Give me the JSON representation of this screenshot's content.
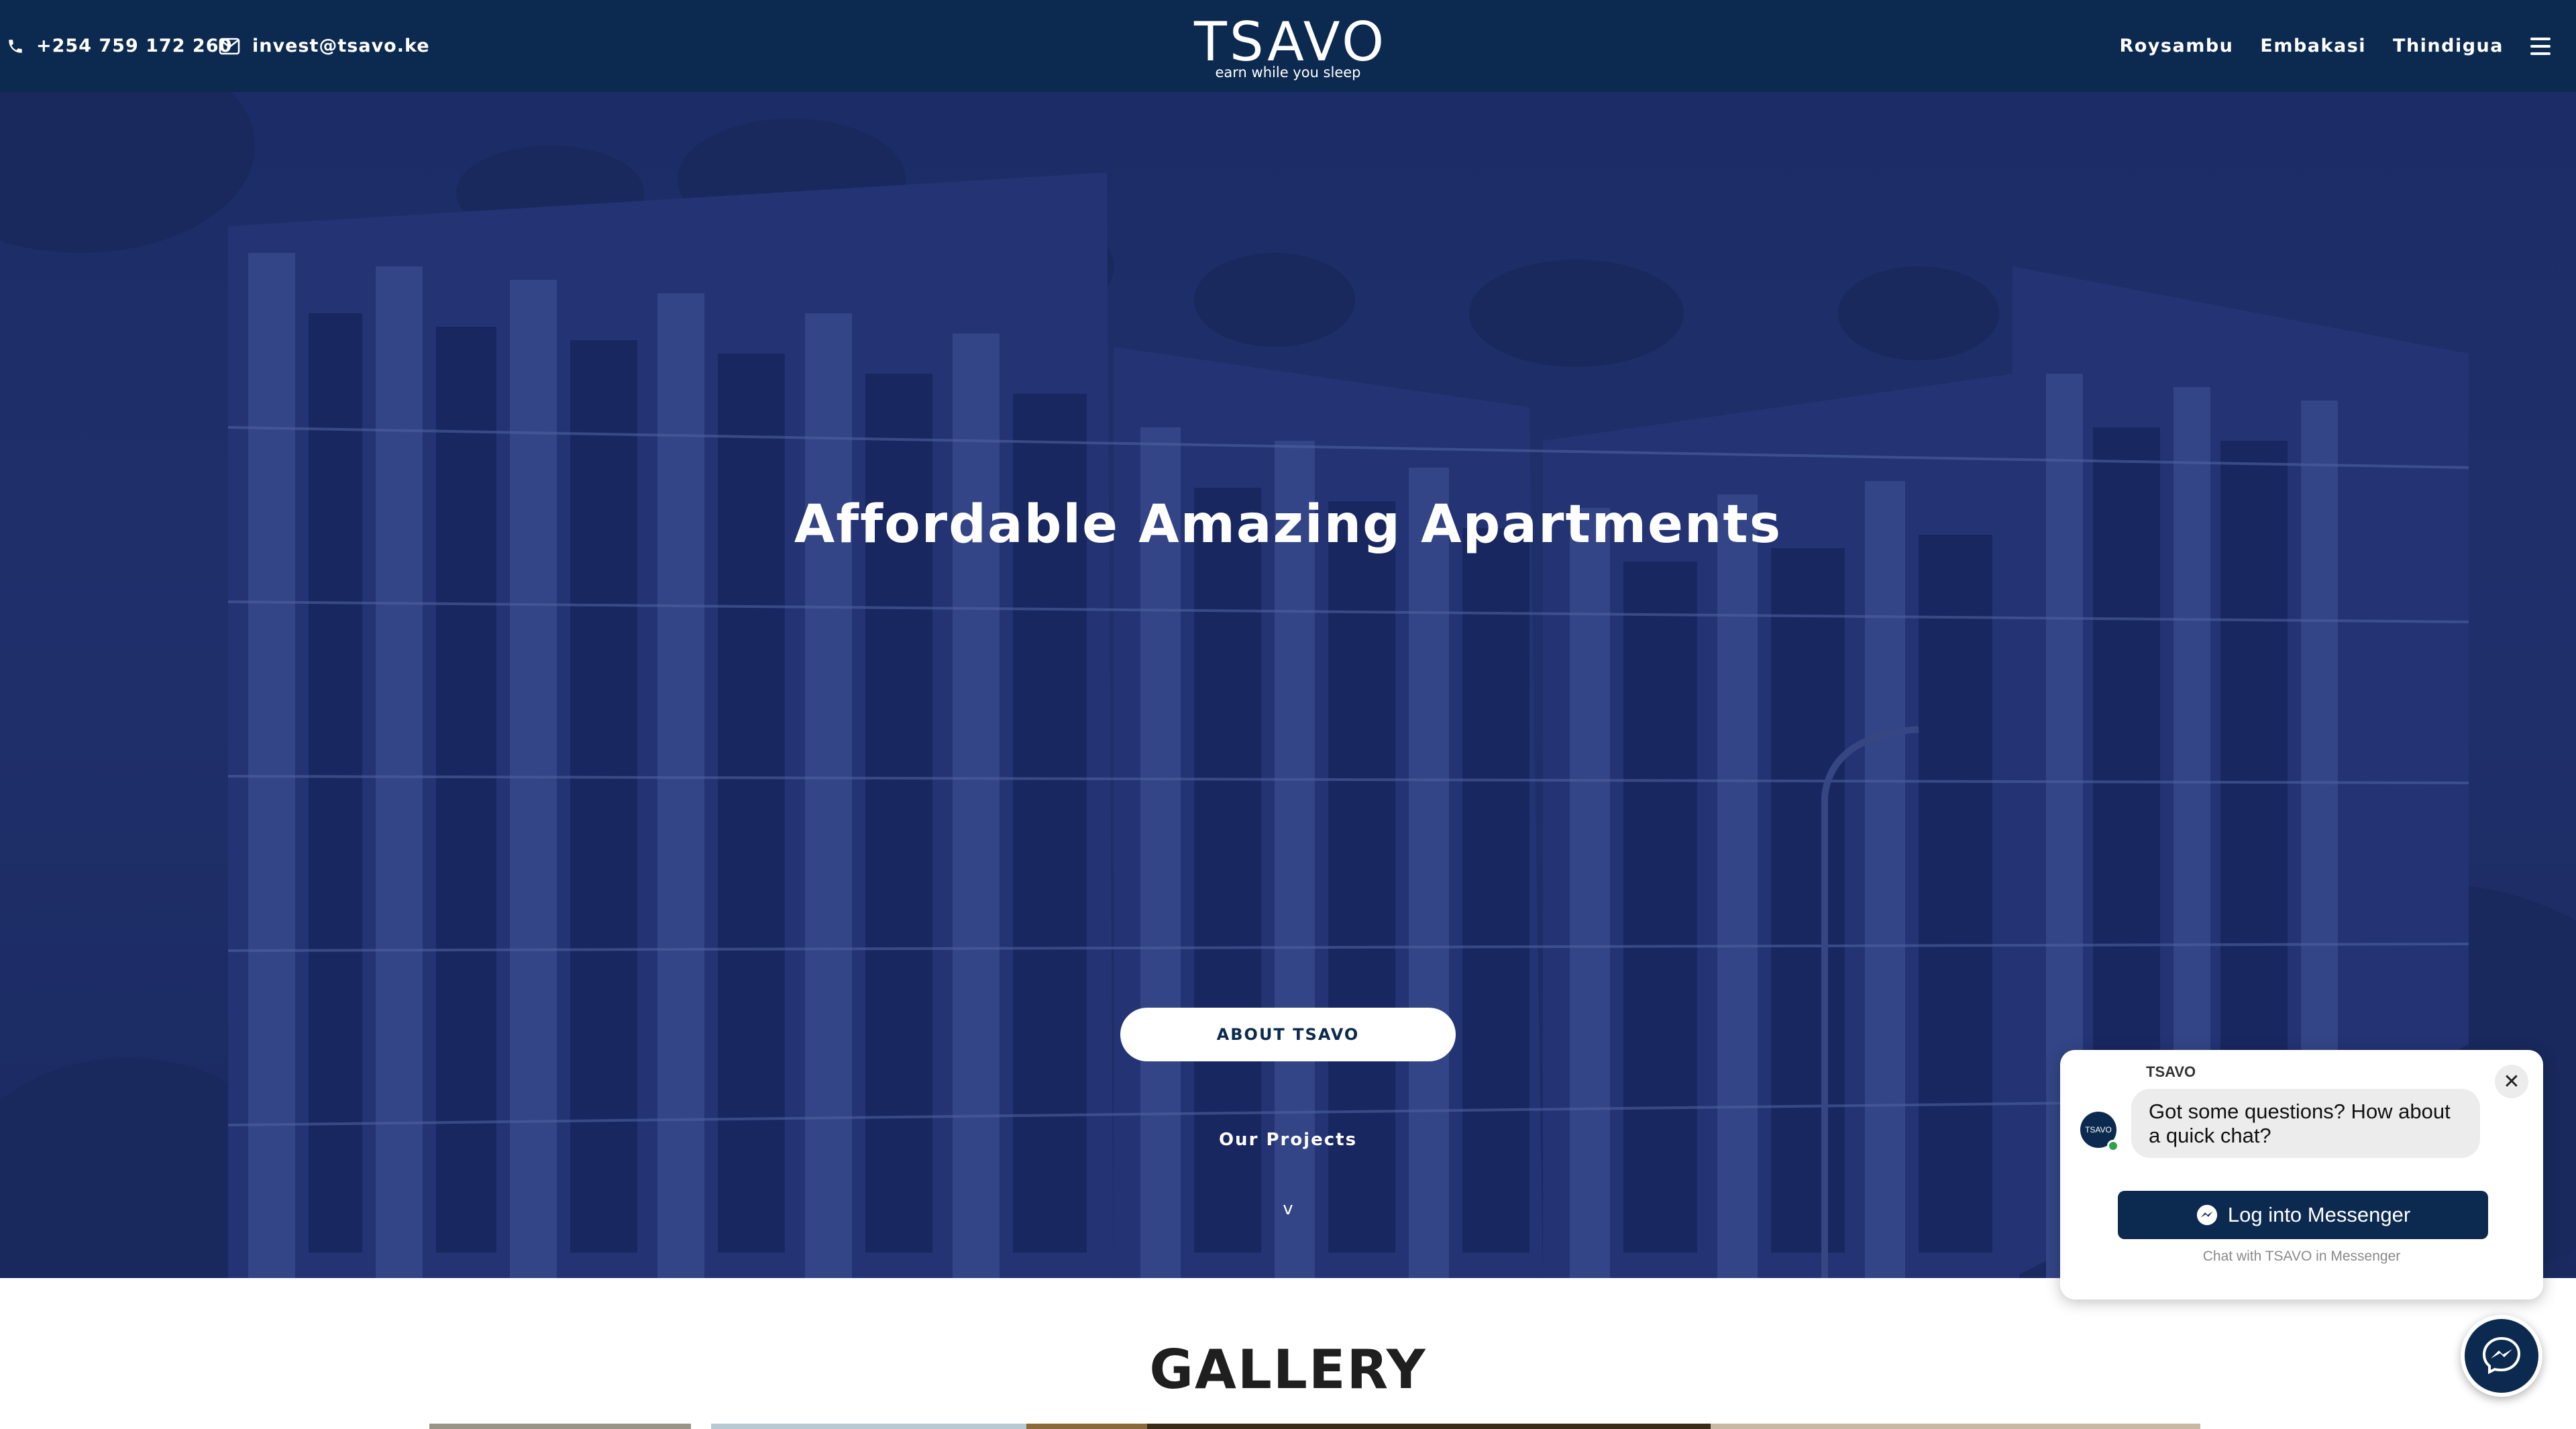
{
  "header": {
    "phone": "+254 759 172 260",
    "email": "invest@tsavo.ke",
    "logo_text": "TSAVO",
    "logo_tagline": "earn while you sleep",
    "nav": [
      "Roysambu",
      "Embakasi",
      "Thindigua"
    ],
    "menu_icon": "hamburger-icon"
  },
  "hero": {
    "title": "Affordable Amazing Apartments",
    "button_label": "ABOUT TSAVO",
    "projects_label": "Our Projects",
    "scroll_indicator": "v"
  },
  "gallery": {
    "title": "GALLERY"
  },
  "chat": {
    "brand": "TSAVO",
    "avatar_text": "TSAVO",
    "message": "Got some questions? How about a quick chat?",
    "login_label": "Log into Messenger",
    "subtext": "Chat with TSAVO in Messenger",
    "close_icon": "close-icon",
    "fab_icon": "messenger-icon"
  },
  "colors": {
    "navy": "#0c2a4f",
    "hero_tint": "#22336f",
    "white": "#ffffff",
    "online": "#31a24c"
  }
}
